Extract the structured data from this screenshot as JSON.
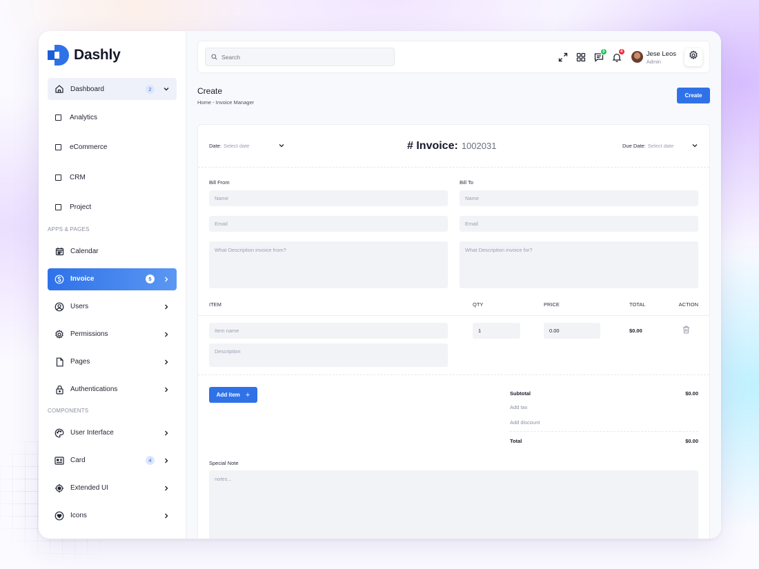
{
  "brand": {
    "name": "Dashly",
    "accent": "#2f72e8"
  },
  "sidebar": {
    "dashboard": {
      "label": "Dashboard",
      "badge": "2",
      "icon": "home-icon"
    },
    "dashboard_sub": [
      "Analytics",
      "eCommerce",
      "CRM",
      "Project"
    ],
    "section_apps": "APPS & PAGES",
    "calendar": "Calendar",
    "invoice": {
      "label": "Invoice",
      "badge": "5"
    },
    "users": "Users",
    "permissions": "Permissions",
    "pages": "Pages",
    "authentications": "Authentications",
    "section_components": "COMPONENTS",
    "user_interface": "User Interface",
    "card": {
      "label": "Card",
      "badge": "4"
    },
    "extended_ui": "Extended UI",
    "icons": "Icons"
  },
  "topbar": {
    "search_placeholder": "Search",
    "messages_badge": "3",
    "notifications_badge": "4",
    "user_name": "Jese Leos",
    "user_role": "Admin"
  },
  "page": {
    "title": "Create",
    "breadcrumb": "Home - Invoice Manager",
    "create_button": "Create"
  },
  "invoice": {
    "date_label": "Date:",
    "date_placeholder": "Select date",
    "title": "# Invoice:",
    "number": "1002031",
    "due_label": "Due Date:",
    "due_placeholder": "Select date",
    "bill_from": "Bill From",
    "bill_to": "Bill To",
    "name_placeholder": "Name",
    "email_placeholder": "Email",
    "desc_from_placeholder": "What Description invoice from?",
    "desc_for_placeholder": "What Description invoice for?",
    "columns": {
      "item": "ITEM",
      "qty": "QTY",
      "price": "PRICE",
      "total": "TOTAL",
      "action": "ACTION"
    },
    "item_name_placeholder": "Item name",
    "item_desc_placeholder": "Description",
    "qty_value": "1",
    "price_value": "0.00",
    "line_total": "$0.00",
    "add_item": "Add item",
    "subtotal_label": "Subtotal",
    "subtotal_value": "$0.00",
    "add_tax": "Add tax",
    "add_discount": "Add discount",
    "total_label": "Total",
    "total_value": "$0.00",
    "special_note": "Special Note",
    "notes_placeholder": "notes..."
  }
}
